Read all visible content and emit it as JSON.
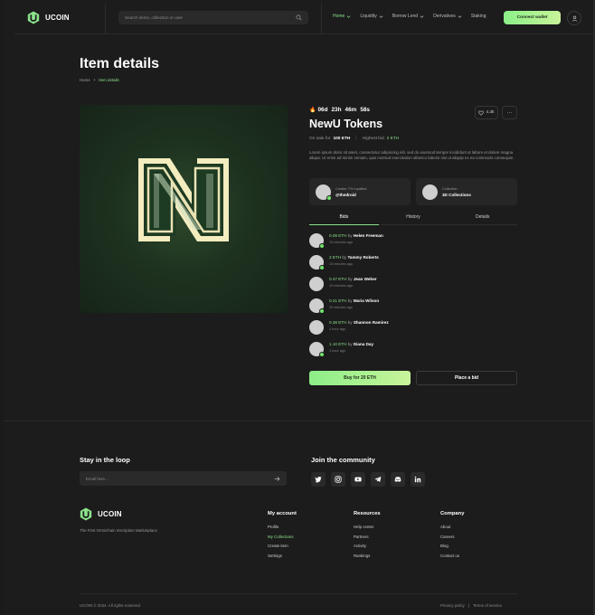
{
  "brand": {
    "name": "UCOIN",
    "accent": "#8be28a",
    "logo_icon": "shield-u-logo"
  },
  "header": {
    "search_placeholder": "Search items, collection or user",
    "nav": [
      {
        "label": "Home",
        "active": true
      },
      {
        "label": "Liquidity",
        "active": false
      },
      {
        "label": "Borrow Lend",
        "active": false
      },
      {
        "label": "Derivatives",
        "active": false
      },
      {
        "label": "Staking",
        "active": false
      }
    ],
    "connect_label": "Connect wallet"
  },
  "page": {
    "title": "Item details",
    "breadcrumb": {
      "home": "Home",
      "sep": "•",
      "current": "Item details"
    }
  },
  "item": {
    "timer": {
      "days": "06d",
      "hours": "23h",
      "minutes": "46m",
      "seconds": "58s"
    },
    "title": "NewU Tokens",
    "likes": "4.3k",
    "more": "···",
    "on_sale_label": "On sale for",
    "on_sale_value": "100 ETH",
    "highest_bid_label": "Highest bid",
    "highest_bid_value": "2 ETH",
    "description": "Lorem ipsum dolor sit amet, consectetur adipiscing elit, sed do eiusmod tempor incididunt ut labore et dolore magna aliqua. Ut enim ad minim veniam, quis nostrud exercitation ullamco laboris nisi ut aliquip ex ea commodo consequat.",
    "creator": {
      "label": "Creator  7% royalties",
      "value": "@thedroid"
    },
    "collection": {
      "label": "Collection",
      "value": "3D Collections"
    }
  },
  "tabs": [
    {
      "label": "Bids",
      "active": true
    },
    {
      "label": "History",
      "active": false
    },
    {
      "label": "Details",
      "active": false
    }
  ],
  "bids": [
    {
      "amount": "0.09 ETH",
      "by": "by",
      "user": "Helen Freeman",
      "time": "10 minutes ago"
    },
    {
      "amount": "2 ETH",
      "by": "by",
      "user": "Tammy Roberts",
      "time": "10 minutes ago"
    },
    {
      "amount": "0.47 ETH",
      "by": "by",
      "user": "Jean Weber",
      "time": "10 minutes ago"
    },
    {
      "amount": "0.21 ETH",
      "by": "by",
      "user": "Maria Wilson",
      "time": "20 minutes ago"
    },
    {
      "amount": "0.38 ETH",
      "by": "by",
      "user": "Shannon Ramirez",
      "time": "1 hour ago"
    },
    {
      "amount": "1.10 ETH",
      "by": "by",
      "user": "Diana Day",
      "time": "1 hour ago"
    }
  ],
  "actions": {
    "buy_label": "Buy for 20 ETH",
    "bid_label": "Place a bid"
  },
  "footer": {
    "newsletter_title": "Stay in the loop",
    "email_placeholder": "Email here...",
    "community_title": "Join the community",
    "socials": [
      "twitter-icon",
      "instagram-icon",
      "youtube-icon",
      "telegram-icon",
      "discord-icon",
      "linkedin-icon"
    ],
    "tagline": "The First Omnichain Inscription Marketplace",
    "columns": [
      {
        "title": "My account",
        "links": [
          {
            "label": "Profile"
          },
          {
            "label": "My Collections",
            "highlight": true
          },
          {
            "label": "Create item"
          },
          {
            "label": "Settings"
          }
        ]
      },
      {
        "title": "Resources",
        "links": [
          {
            "label": "Help center"
          },
          {
            "label": "Partners"
          },
          {
            "label": "Activity"
          },
          {
            "label": "Rankings"
          }
        ]
      },
      {
        "title": "Company",
        "links": [
          {
            "label": "About"
          },
          {
            "label": "Careers"
          },
          {
            "label": "Blog"
          },
          {
            "label": "Contact us"
          }
        ]
      }
    ],
    "copyright": "UCOIN © 2024. All rights reserved",
    "privacy": "Privacy policy",
    "legal_sep": "|",
    "terms": "Terms of service"
  }
}
